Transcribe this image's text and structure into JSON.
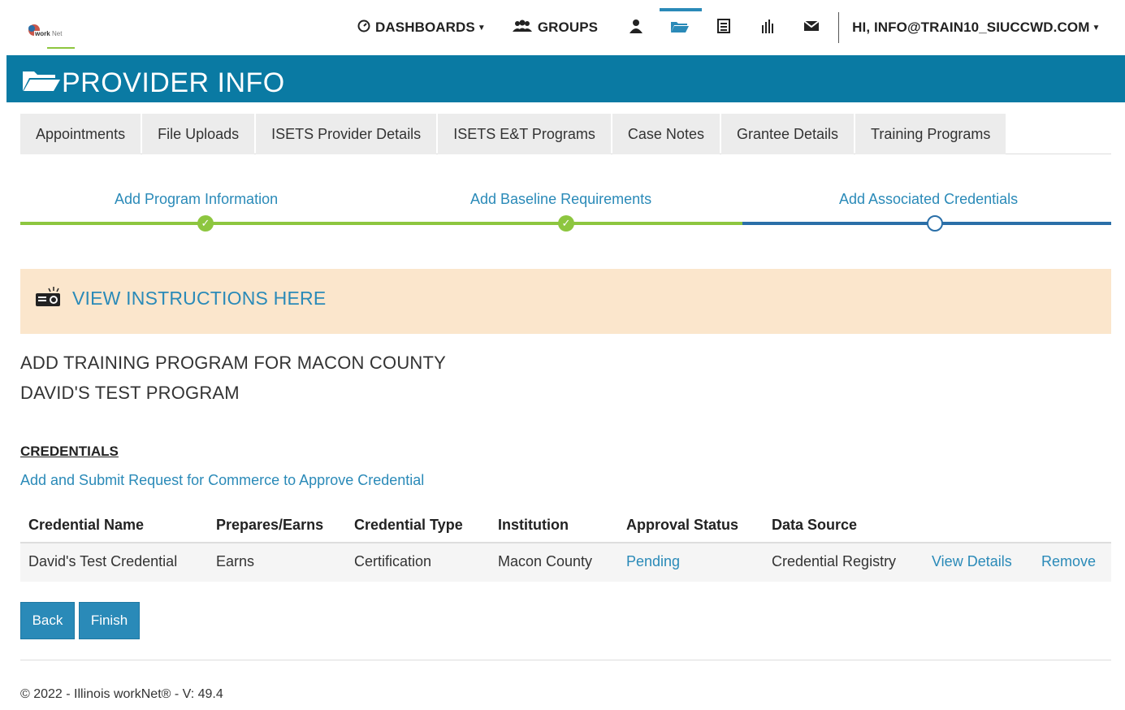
{
  "nav": {
    "dashboards_label": "DASHBOARDS",
    "groups_label": "GROUPS",
    "user_greeting": "HI, INFO@TRAIN10_SIUCCWD.COM",
    "icons": [
      "person-icon",
      "folder-icon",
      "list-icon",
      "chart-icon",
      "mail-icon"
    ]
  },
  "banner": {
    "title": "PROVIDER INFO"
  },
  "tabs": [
    {
      "label": "Appointments"
    },
    {
      "label": "File Uploads"
    },
    {
      "label": "ISETS Provider Details"
    },
    {
      "label": "ISETS E&T Programs"
    },
    {
      "label": "Case Notes"
    },
    {
      "label": "Grantee Details"
    },
    {
      "label": "Training Programs"
    }
  ],
  "stepper": {
    "steps": [
      {
        "label": "Add Program Information",
        "status": "complete"
      },
      {
        "label": "Add Baseline Requirements",
        "status": "complete"
      },
      {
        "label": "Add Associated Credentials",
        "status": "current"
      }
    ]
  },
  "instructions": {
    "label": "VIEW INSTRUCTIONS HERE"
  },
  "page": {
    "heading": "ADD TRAINING PROGRAM FOR MACON COUNTY",
    "subheading": "DAVID'S TEST PROGRAM"
  },
  "credentials": {
    "title": "CREDENTIALS",
    "request_link": "Add and Submit Request for Commerce to Approve Credential",
    "columns": [
      "Credential Name",
      "Prepares/Earns",
      "Credential Type",
      "Institution",
      "Approval Status",
      "Data Source"
    ],
    "rows": [
      {
        "name": "David's Test Credential",
        "prepares_earns": "Earns",
        "type": "Certification",
        "institution": "Macon County",
        "status": "Pending",
        "source": "Credential Registry",
        "view_label": "View Details",
        "remove_label": "Remove"
      }
    ]
  },
  "buttons": {
    "back": "Back",
    "finish": "Finish"
  },
  "footer": {
    "text": "© 2022 - Illinois workNet® - V: 49.4"
  },
  "colors": {
    "banner": "#0a7aa3",
    "link": "#2a8ab8",
    "done": "#8dc63f",
    "instructions_bg": "#fbe6cc"
  }
}
